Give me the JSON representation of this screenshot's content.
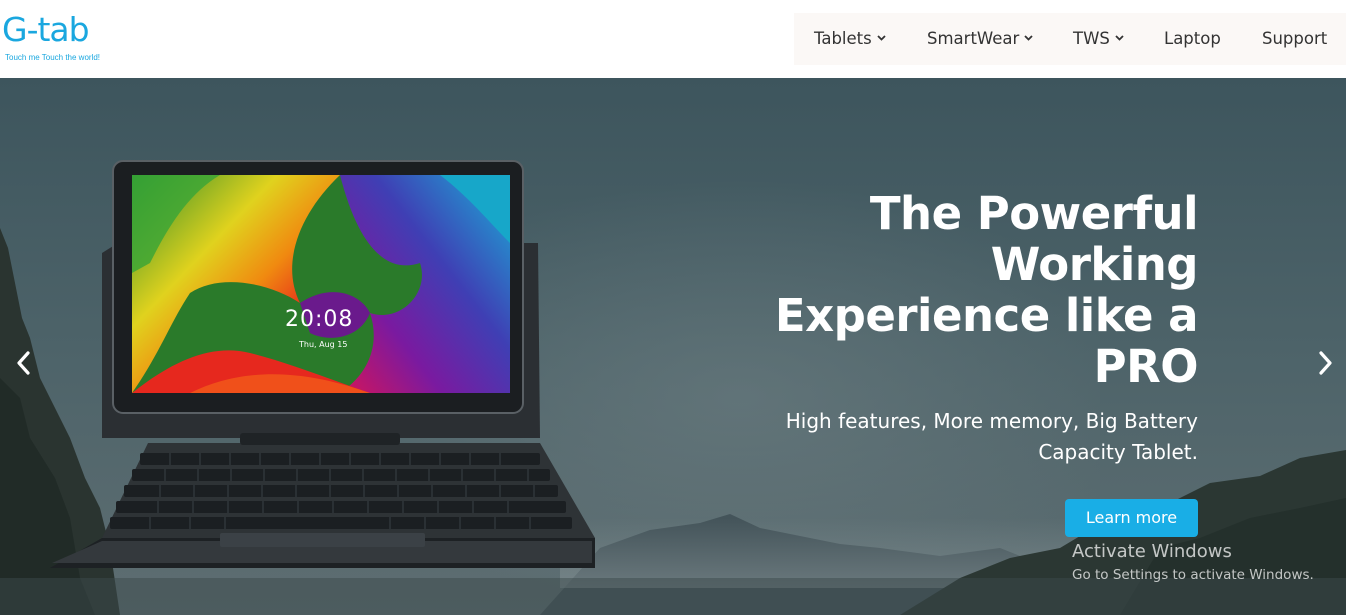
{
  "brand": {
    "logo_text": "G-tab",
    "tagline": "Touch me Touch the world!",
    "accent_color": "#1aa7df"
  },
  "nav": {
    "items": [
      {
        "label": "Tablets",
        "has_dropdown": true
      },
      {
        "label": "SmartWear",
        "has_dropdown": true
      },
      {
        "label": "TWS",
        "has_dropdown": true
      },
      {
        "label": "Laptop",
        "has_dropdown": false
      },
      {
        "label": "Support",
        "has_dropdown": false
      }
    ]
  },
  "hero": {
    "headline": "The Powerful Working Experience like a PRO",
    "subline": "High features, More memory, Big Battery Capacity Tablet.",
    "cta_label": "Learn more",
    "cta_color": "#19aee6",
    "prev_icon": "chevron-left-icon",
    "next_icon": "chevron-right-icon",
    "tablet_screen": {
      "time": "20:08",
      "date": "Thu, Aug 15"
    }
  },
  "os_watermark": {
    "title": "Activate Windows",
    "subtitle": "Go to Settings to activate Windows."
  }
}
